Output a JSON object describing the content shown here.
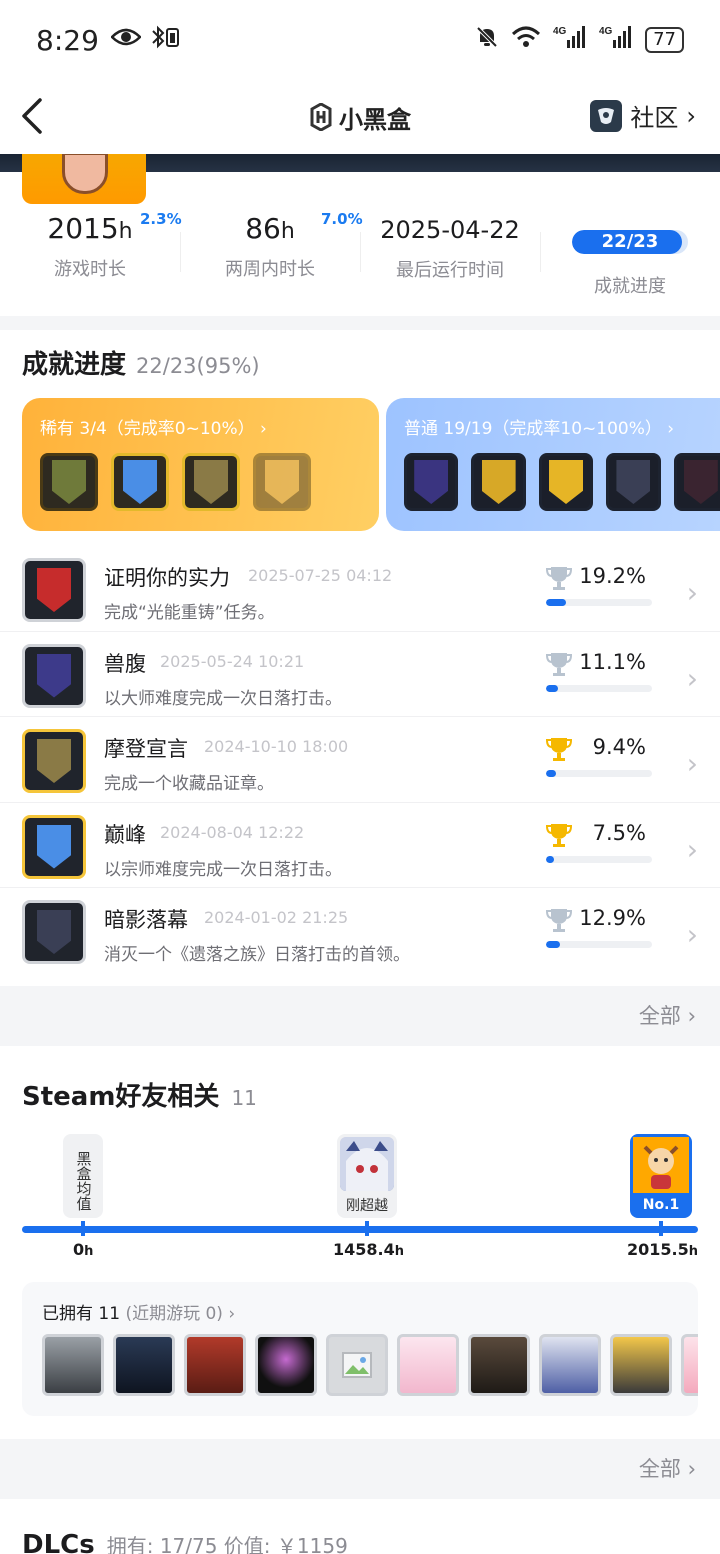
{
  "status_bar": {
    "time": "8:29",
    "battery": "77",
    "icons": [
      "eye-icon",
      "bluetooth-icon",
      "mute-bell-icon",
      "wifi-icon",
      "signal-4g-icon",
      "signal-4g-icon"
    ]
  },
  "nav": {
    "app_name": "小黑盒",
    "community_label": "社区"
  },
  "stats": [
    {
      "value": "2015",
      "unit": "h",
      "label": "游戏时长",
      "percent": "2.3%"
    },
    {
      "value": "86",
      "unit": "h",
      "label": "两周内时长",
      "percent": "7.0%"
    },
    {
      "value": "2025-04-22",
      "unit": "",
      "label": "最后运行时间",
      "percent": ""
    },
    {
      "value": "22/23",
      "unit": "",
      "label": "成就进度",
      "percent": "",
      "progress": 0.95
    }
  ],
  "achievements": {
    "title": "成就进度",
    "count": "22/23",
    "percent": "(95%)",
    "categories": [
      {
        "title": "稀有 3/4（完成率0~10%）",
        "chevron": "›"
      },
      {
        "title": "普通 19/19（完成率10~100%）",
        "chevron": "›"
      }
    ],
    "items": [
      {
        "name": "证明你的实力",
        "date": "2025-07-25 04:12",
        "desc": "完成“光能重铸”任务。",
        "percent": "19.2%",
        "value": 19.2,
        "trophy": "silver"
      },
      {
        "name": "兽腹",
        "date": "2025-05-24 10:21",
        "desc": "以大师难度完成一次日落打击。",
        "percent": "11.1%",
        "value": 11.1,
        "trophy": "silver"
      },
      {
        "name": "摩登宣言",
        "date": "2024-10-10 18:00",
        "desc": "完成一个收藏品证章。",
        "percent": "9.4%",
        "value": 9.4,
        "trophy": "gold"
      },
      {
        "name": "巅峰",
        "date": "2024-08-04 12:22",
        "desc": "以宗师难度完成一次日落打击。",
        "percent": "7.5%",
        "value": 7.5,
        "trophy": "gold"
      },
      {
        "name": "暗影落幕",
        "date": "2024-01-02 21:25",
        "desc": "消灭一个《遗落之族》日落打击的首领。",
        "percent": "12.9%",
        "value": 12.9,
        "trophy": "silver"
      }
    ],
    "more_label": "全部"
  },
  "steam_friends": {
    "title": "Steam好友相关",
    "count": "11",
    "avg_label": "黑盒均值",
    "friend_label": "刚超越",
    "me_label": "No.1",
    "ticks": [
      {
        "value": "0",
        "unit": "h"
      },
      {
        "value": "1458.4",
        "unit": "h"
      },
      {
        "value": "2015.5",
        "unit": "h"
      }
    ],
    "owned_label": "已拥有",
    "owned_count": "11",
    "recent_label": "(近期游玩 0)",
    "more_label": "全部"
  },
  "dlc": {
    "title": "DLCs",
    "summary": "拥有: 17/75 价值: ￥1159"
  },
  "colors": {
    "accent": "#1a6fee",
    "rare": "#ffb23a",
    "normal": "#9dc3ff",
    "gold_trophy": "#f5b800",
    "silver_trophy": "#b8c3cf"
  }
}
